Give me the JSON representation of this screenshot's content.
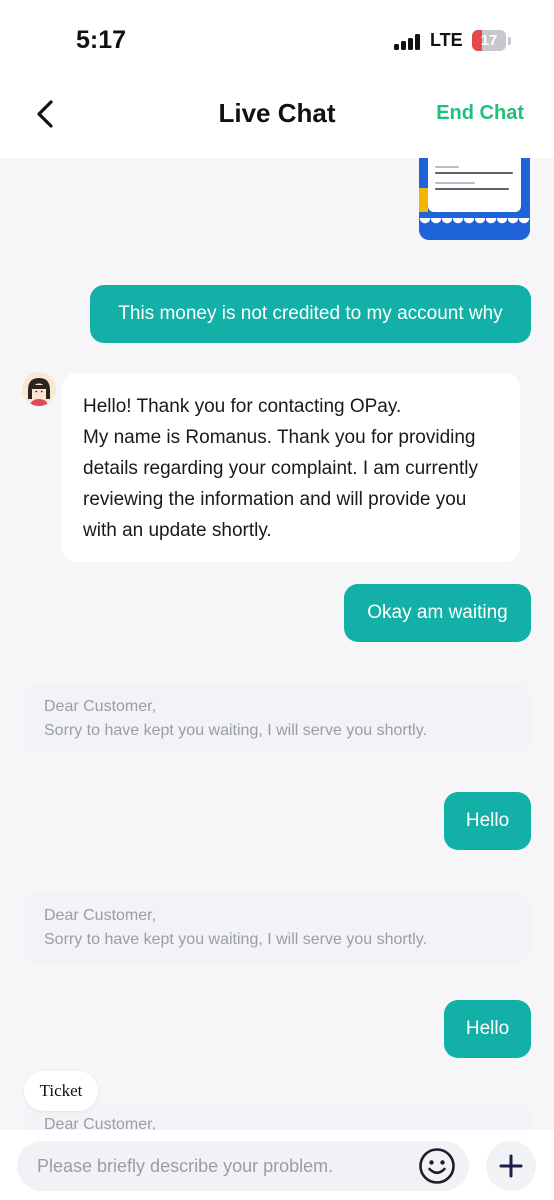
{
  "status_bar": {
    "time": "5:17",
    "network": "LTE",
    "battery_level": "17",
    "battery_color": "#e34949"
  },
  "header": {
    "back_icon": "chevron-left-icon",
    "title": "Live Chat",
    "end_chat_label": "End Chat",
    "accent_color": "#1fc17b"
  },
  "chat": {
    "messages": [
      {
        "type": "image",
        "sender": "user",
        "content": "transaction-receipt-image"
      },
      {
        "type": "text",
        "sender": "user",
        "text": "This money is not credited to my account why"
      },
      {
        "type": "text",
        "sender": "agent",
        "lines": [
          "Hello! Thank you for contacting OPay.",
          "My name is Romanus. Thank you for providing",
          "details regarding your complaint. I am currently",
          "reviewing the information and will provide you",
          "with an update shortly."
        ]
      },
      {
        "type": "text",
        "sender": "user",
        "text": "Okay am waiting"
      },
      {
        "type": "system",
        "lines": [
          "Dear Customer,",
          "Sorry to have kept you waiting, I will serve you shortly."
        ]
      },
      {
        "type": "text",
        "sender": "user",
        "text": "Hello"
      },
      {
        "type": "system",
        "lines": [
          "Dear Customer,",
          "Sorry to have kept you waiting, I will serve you shortly."
        ]
      },
      {
        "type": "text",
        "sender": "user",
        "text": "Hello"
      },
      {
        "type": "system",
        "lines": [
          "Dear Customer,"
        ]
      }
    ],
    "user_bubble_color": "#12b0a6"
  },
  "ticket": {
    "label": "Ticket"
  },
  "input": {
    "placeholder": "Please briefly describe your problem.",
    "emoji_icon": "smiley-icon",
    "add_icon": "plus-icon"
  }
}
